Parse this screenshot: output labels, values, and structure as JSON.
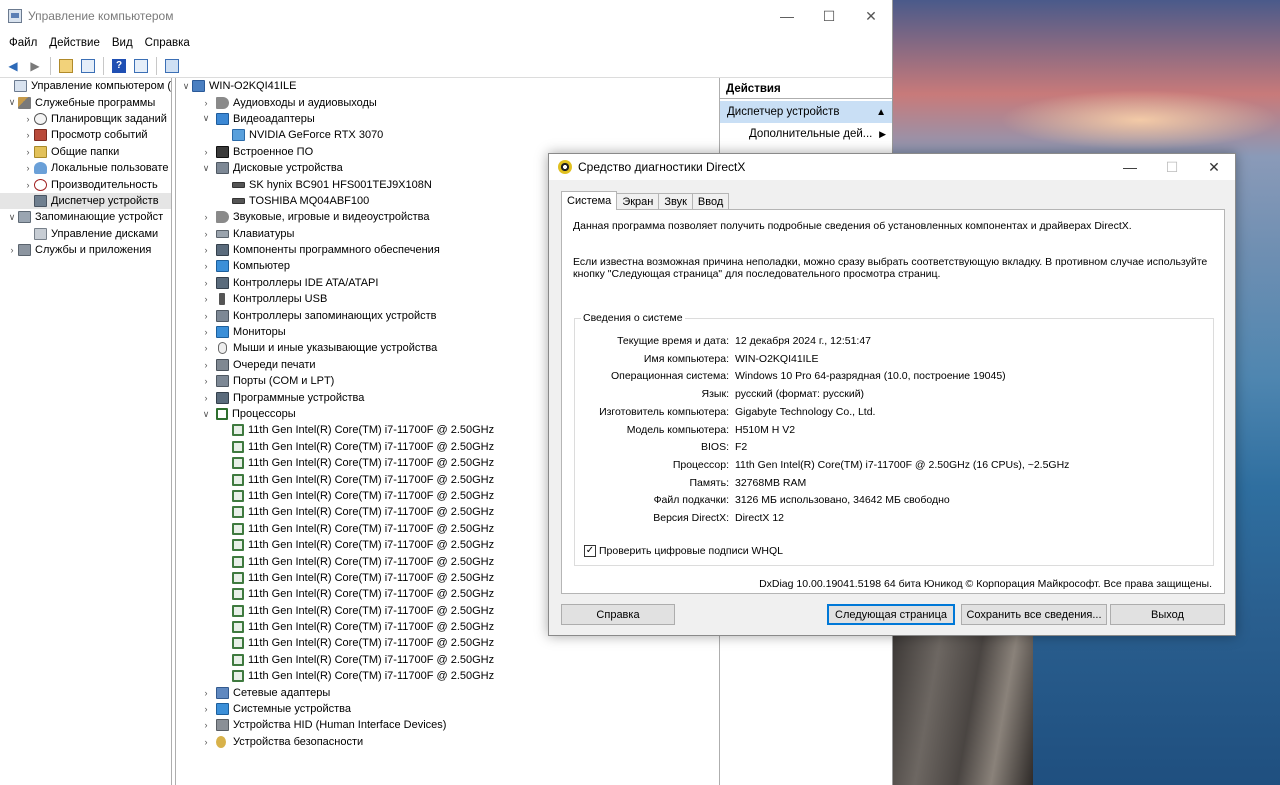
{
  "colors": {
    "selection": "#c9dff5",
    "accent": "#0078d7",
    "cpu_icon": "#3f7a3f"
  },
  "cm": {
    "title": "Управление компьютером",
    "window_controls": {
      "minimize": "—",
      "maximize": "☐",
      "close": "✕"
    },
    "menu": [
      "Файл",
      "Действие",
      "Вид",
      "Справка"
    ],
    "toolbar_icons": [
      "back-arrow-icon",
      "forward-arrow-icon",
      "up-folder-icon",
      "properties-icon",
      "help-icon",
      "show-hide-tree-icon",
      "computer-icon"
    ],
    "left_tree": [
      {
        "label": "Управление компьютером (л",
        "twisty": "",
        "icon": "computer-management-icon"
      },
      {
        "label": "Служебные программы",
        "twisty": "∨",
        "icon": "tools-icon"
      },
      {
        "label": "Планировщик заданий",
        "twisty": "›",
        "icon": "clock-icon"
      },
      {
        "label": "Просмотр событий",
        "twisty": "›",
        "icon": "event-viewer-icon"
      },
      {
        "label": "Общие папки",
        "twisty": "›",
        "icon": "shared-folder-icon"
      },
      {
        "label": "Локальные пользовате",
        "twisty": "›",
        "icon": "users-icon"
      },
      {
        "label": "Производительность",
        "twisty": "›",
        "icon": "performance-icon"
      },
      {
        "label": "Диспетчер устройств",
        "twisty": "",
        "icon": "device-manager-icon",
        "selected": true
      },
      {
        "label": "Запоминающие устройст",
        "twisty": "∨",
        "icon": "storage-icon"
      },
      {
        "label": "Управление дисками",
        "twisty": "",
        "icon": "disk-management-icon"
      },
      {
        "label": "Службы и приложения",
        "twisty": "›",
        "icon": "services-icon"
      }
    ],
    "device_tree": {
      "root": "WIN-O2KQI41ILE",
      "items": [
        {
          "label": "Аудиовходы и аудиовыходы",
          "twisty": "›",
          "icon": "audio-icon"
        },
        {
          "label": "Видеоадаптеры",
          "twisty": "∨",
          "icon": "display-adapter-icon"
        },
        {
          "label": "NVIDIA GeForce RTX 3070",
          "child": true,
          "icon": "gpu-icon"
        },
        {
          "label": "Встроенное ПО",
          "twisty": "›",
          "icon": "firmware-icon"
        },
        {
          "label": "Дисковые устройства",
          "twisty": "∨",
          "icon": "disk-drive-icon"
        },
        {
          "label": "SK hynix BC901 HFS001TEJ9X108N",
          "child": true,
          "icon": "drive-icon"
        },
        {
          "label": "TOSHIBA MQ04ABF100",
          "child": true,
          "icon": "drive-icon"
        },
        {
          "label": "Звуковые, игровые и видеоустройства",
          "twisty": "›",
          "icon": "sound-icon"
        },
        {
          "label": "Клавиатуры",
          "twisty": "›",
          "icon": "keyboard-icon"
        },
        {
          "label": "Компоненты программного обеспечения",
          "twisty": "›",
          "icon": "software-component-icon"
        },
        {
          "label": "Компьютер",
          "twisty": "›",
          "icon": "computer-icon"
        },
        {
          "label": "Контроллеры IDE ATA/ATAPI",
          "twisty": "›",
          "icon": "ide-controller-icon"
        },
        {
          "label": "Контроллеры USB",
          "twisty": "›",
          "icon": "usb-icon"
        },
        {
          "label": "Контроллеры запоминающих устройств",
          "twisty": "›",
          "icon": "storage-controller-icon"
        },
        {
          "label": "Мониторы",
          "twisty": "›",
          "icon": "monitor-icon"
        },
        {
          "label": "Мыши и иные указывающие устройства",
          "twisty": "›",
          "icon": "mouse-icon"
        },
        {
          "label": "Очереди печати",
          "twisty": "›",
          "icon": "printer-icon"
        },
        {
          "label": "Порты (COM и LPT)",
          "twisty": "›",
          "icon": "port-icon"
        },
        {
          "label": "Программные устройства",
          "twisty": "›",
          "icon": "software-device-icon"
        },
        {
          "label": "Процессоры",
          "twisty": "∨",
          "icon": "processor-icon"
        },
        {
          "label": "11th Gen Intel(R) Core(TM) i7-11700F @ 2.50GHz",
          "child": true,
          "icon": "cpu-icon"
        },
        {
          "label": "11th Gen Intel(R) Core(TM) i7-11700F @ 2.50GHz",
          "child": true,
          "icon": "cpu-icon"
        },
        {
          "label": "11th Gen Intel(R) Core(TM) i7-11700F @ 2.50GHz",
          "child": true,
          "icon": "cpu-icon"
        },
        {
          "label": "11th Gen Intel(R) Core(TM) i7-11700F @ 2.50GHz",
          "child": true,
          "icon": "cpu-icon"
        },
        {
          "label": "11th Gen Intel(R) Core(TM) i7-11700F @ 2.50GHz",
          "child": true,
          "icon": "cpu-icon"
        },
        {
          "label": "11th Gen Intel(R) Core(TM) i7-11700F @ 2.50GHz",
          "child": true,
          "icon": "cpu-icon"
        },
        {
          "label": "11th Gen Intel(R) Core(TM) i7-11700F @ 2.50GHz",
          "child": true,
          "icon": "cpu-icon"
        },
        {
          "label": "11th Gen Intel(R) Core(TM) i7-11700F @ 2.50GHz",
          "child": true,
          "icon": "cpu-icon"
        },
        {
          "label": "11th Gen Intel(R) Core(TM) i7-11700F @ 2.50GHz",
          "child": true,
          "icon": "cpu-icon"
        },
        {
          "label": "11th Gen Intel(R) Core(TM) i7-11700F @ 2.50GHz",
          "child": true,
          "icon": "cpu-icon"
        },
        {
          "label": "11th Gen Intel(R) Core(TM) i7-11700F @ 2.50GHz",
          "child": true,
          "icon": "cpu-icon"
        },
        {
          "label": "11th Gen Intel(R) Core(TM) i7-11700F @ 2.50GHz",
          "child": true,
          "icon": "cpu-icon"
        },
        {
          "label": "11th Gen Intel(R) Core(TM) i7-11700F @ 2.50GHz",
          "child": true,
          "icon": "cpu-icon"
        },
        {
          "label": "11th Gen Intel(R) Core(TM) i7-11700F @ 2.50GHz",
          "child": true,
          "icon": "cpu-icon"
        },
        {
          "label": "11th Gen Intel(R) Core(TM) i7-11700F @ 2.50GHz",
          "child": true,
          "icon": "cpu-icon"
        },
        {
          "label": "11th Gen Intel(R) Core(TM) i7-11700F @ 2.50GHz",
          "child": true,
          "icon": "cpu-icon"
        },
        {
          "label": "Сетевые адаптеры",
          "twisty": "›",
          "icon": "network-adapter-icon"
        },
        {
          "label": "Системные устройства",
          "twisty": "›",
          "icon": "system-device-icon"
        },
        {
          "label": "Устройства HID (Human Interface Devices)",
          "twisty": "›",
          "icon": "hid-icon"
        },
        {
          "label": "Устройства безопасности",
          "twisty": "›",
          "icon": "security-device-icon"
        }
      ]
    },
    "actions": {
      "header": "Действия",
      "selected": "Диспетчер устройств",
      "more": "Дополнительные дей..."
    }
  },
  "dx": {
    "title": "Средство диагностики DirectX",
    "tabs": [
      "Система",
      "Экран",
      "Звук",
      "Ввод"
    ],
    "intro1": "Данная программа позволяет получить подробные сведения об установленных компонентах и драйверах DirectX.",
    "intro2": "Если известна возможная причина неполадки, можно сразу выбрать соответствующую вкладку. В противном случае используйте кнопку \"Следующая страница\" для последовательного просмотра страниц.",
    "group_label": "Сведения о системе",
    "info": [
      {
        "label": "Текущие время и дата:",
        "value": "12 декабря 2024 г., 12:51:47"
      },
      {
        "label": "Имя компьютера:",
        "value": "WIN-O2KQI41ILE"
      },
      {
        "label": "Операционная система:",
        "value": "Windows 10 Pro 64-разрядная (10.0, построение 19045)"
      },
      {
        "label": "Язык:",
        "value": "русский (формат: русский)"
      },
      {
        "label": "Изготовитель компьютера:",
        "value": "Gigabyte Technology Co., Ltd."
      },
      {
        "label": "Модель компьютера:",
        "value": "H510M H V2"
      },
      {
        "label": "BIOS:",
        "value": "F2"
      },
      {
        "label": "Процессор:",
        "value": "11th Gen Intel(R) Core(TM) i7-11700F @ 2.50GHz (16 CPUs), ~2.5GHz"
      },
      {
        "label": "Память:",
        "value": "32768MB RAM"
      },
      {
        "label": "Файл подкачки:",
        "value": "3126 МБ использовано, 34642 МБ свободно"
      },
      {
        "label": "Версия DirectX:",
        "value": "DirectX 12"
      }
    ],
    "whql_label": "Проверить цифровые подписи WHQL",
    "whql_checked": true,
    "footer": "DxDiag 10.00.19041.5198 64 бита Юникод  © Корпорация Майкрософт. Все права защищены.",
    "buttons": {
      "help": "Справка",
      "next": "Следующая страница",
      "save": "Сохранить все сведения...",
      "exit": "Выход"
    }
  }
}
